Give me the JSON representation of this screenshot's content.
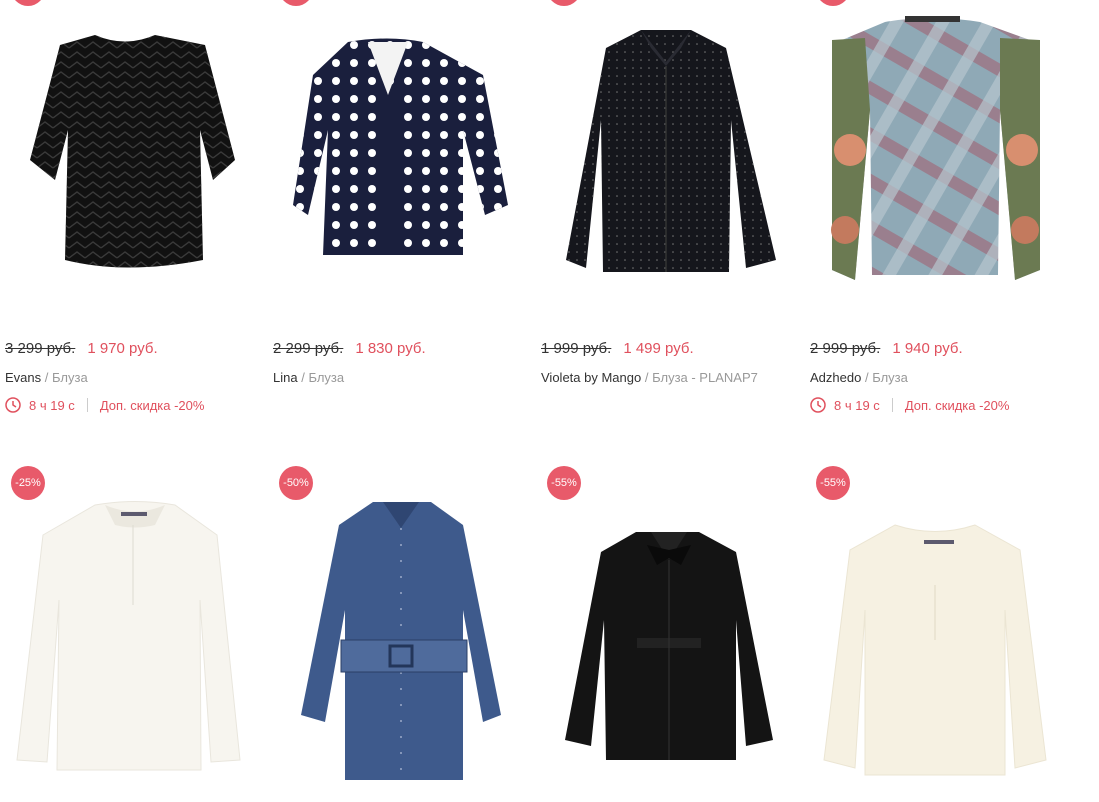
{
  "products_row1": [
    {
      "old_price": "3 299 руб.",
      "new_price": "1 970 руб.",
      "brand": "Evans",
      "type": "Блуза",
      "timer": "8 ч 19 с",
      "extra": "Доп. скидка -20%"
    },
    {
      "old_price": "2 299 руб.",
      "new_price": "1 830 руб.",
      "brand": "Lina",
      "type": "Блуза"
    },
    {
      "old_price": "1 999 руб.",
      "new_price": "1 499 руб.",
      "brand": "Violeta by Mango",
      "type": "Блуза - PLANAP7"
    },
    {
      "old_price": "2 999 руб.",
      "new_price": "1 940 руб.",
      "brand": "Adzhedo",
      "type": "Блуза",
      "timer": "8 ч 19 с",
      "extra": "Доп. скидка -20%"
    }
  ],
  "products_row2": [
    {
      "discount": "-25%"
    },
    {
      "discount": "-50%"
    },
    {
      "discount": "-55%"
    },
    {
      "discount": "-55%"
    }
  ],
  "separator": "/",
  "colors": {
    "accent": "#e0505d",
    "badge": "#e85a6a"
  },
  "icons": {
    "timer": "clock-icon"
  }
}
